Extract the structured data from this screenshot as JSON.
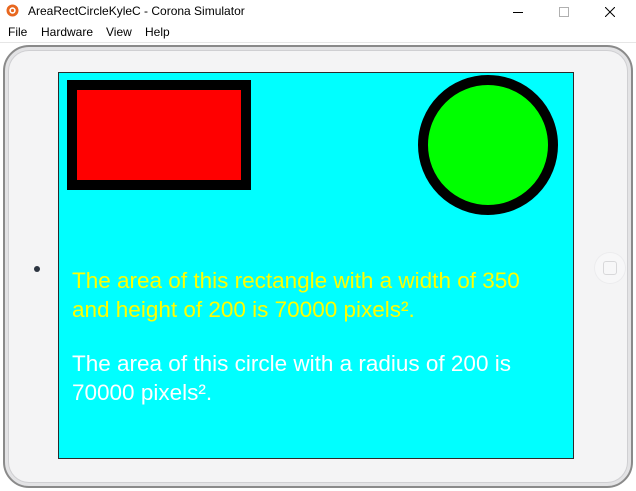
{
  "window": {
    "title": "AreaRectCircleKyleC - Corona Simulator",
    "app_icon": "corona-logo-icon",
    "controls": {
      "minimize_icon": "minimize-icon",
      "maximize_icon": "maximize-icon",
      "close_icon": "close-icon"
    }
  },
  "menubar": {
    "items": [
      {
        "label": "File"
      },
      {
        "label": "Hardware"
      },
      {
        "label": "View"
      },
      {
        "label": "Help"
      }
    ]
  },
  "simulator": {
    "device": "tablet",
    "screen_background": "#00ffff",
    "rectangle": {
      "fill": "#ff0000",
      "stroke": "#000000"
    },
    "circle": {
      "fill": "#00ff00",
      "stroke": "#000000"
    },
    "rectangle_text": {
      "text": "The area of this rectangle with a width of 350 and height of 200 is 70000 pixels².",
      "color": "#ffff00"
    },
    "circle_text": {
      "text": "The area of this circle with a radius of 200 is 70000 pixels².",
      "color": "#ffffff"
    }
  }
}
